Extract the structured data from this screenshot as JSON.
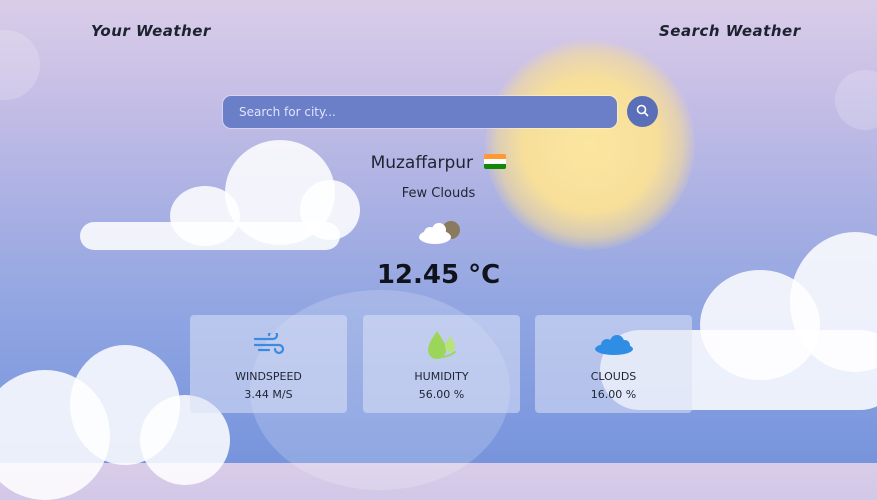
{
  "header": {
    "nav_left": "Your Weather",
    "nav_right": "Search Weather"
  },
  "search": {
    "placeholder": "Search for city...",
    "button_icon": "search-icon"
  },
  "weather": {
    "city": "Muzaffarpur",
    "country_flag": "india-flag-icon",
    "description": "Few Clouds",
    "condition_icon": "few-clouds-icon",
    "temperature": "12.45 °C"
  },
  "stats": [
    {
      "icon": "wind-icon",
      "label": "WINDSPEED",
      "value": "3.44 M/S"
    },
    {
      "icon": "humidity-icon",
      "label": "HUMIDITY",
      "value": "56.00 %"
    },
    {
      "icon": "cloud-icon",
      "label": "CLOUDS",
      "value": "16.00 %"
    }
  ],
  "colors": {
    "search_bg": "#6a7fc8",
    "search_button": "#5a6fb8",
    "wind_icon": "#3a8be0",
    "humidity_icon": "#9bd65a",
    "cloud_icon": "#2f8de4"
  }
}
